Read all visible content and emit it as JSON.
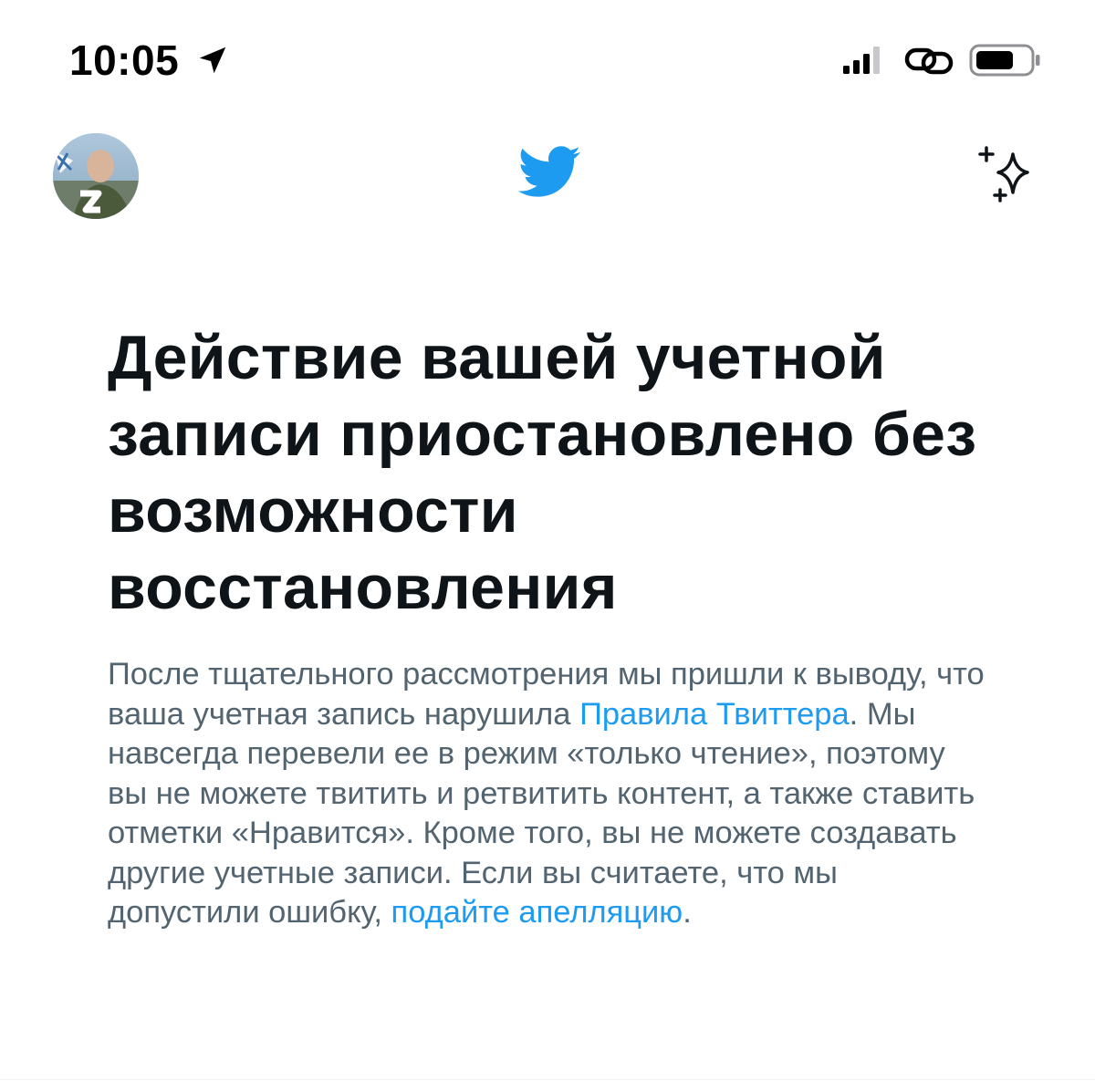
{
  "status_bar": {
    "time": "10:05",
    "location_icon": "location-arrow-icon",
    "signal_icon": "cellular-signal-icon",
    "link_icon": "personal-hotspot-icon",
    "battery_icon": "battery-icon"
  },
  "header": {
    "avatar": "profile-avatar",
    "logo_icon": "twitter-bird-icon",
    "sparkle_icon": "sparkle-icon"
  },
  "content": {
    "headline": "Действие вашей учетной записи приостановлено без возможности восстановления",
    "body_part1": "После тщательного рассмотрения мы пришли к выводу, что ваша учетная запись нарушила ",
    "rules_link": "Правила Твиттера",
    "body_part2": ". Мы навсегда перевели ее в режим «только чтение», поэтому вы не можете твитить и ретвитить контент, а также ставить отметки «Нравится». Кроме того, вы не можете создавать другие учетные записи. Если вы считаете, что мы допустили ошибку, ",
    "appeal_link": "подайте апелляцию",
    "body_part3": "."
  },
  "colors": {
    "brand_blue": "#1d9bf0",
    "headline": "#0f1419",
    "body": "#536471",
    "background": "#ffffff"
  }
}
